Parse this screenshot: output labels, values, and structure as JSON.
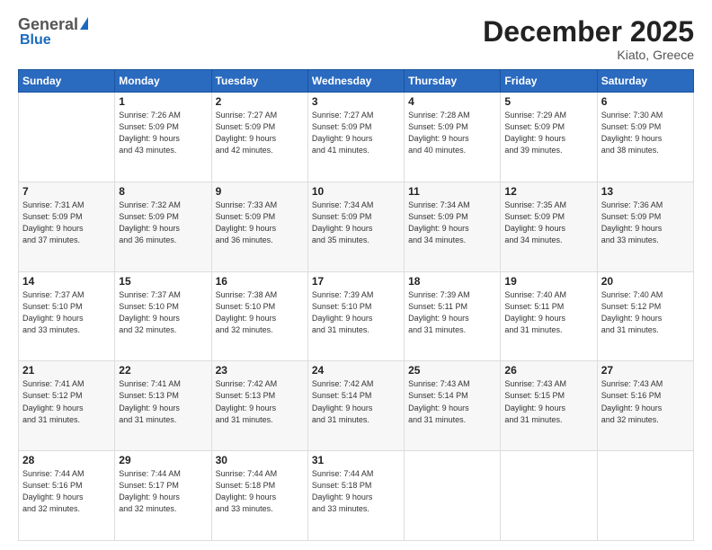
{
  "header": {
    "logo_general": "General",
    "logo_blue": "Blue",
    "month_title": "December 2025",
    "location": "Kiato, Greece"
  },
  "weekdays": [
    "Sunday",
    "Monday",
    "Tuesday",
    "Wednesday",
    "Thursday",
    "Friday",
    "Saturday"
  ],
  "weeks": [
    [
      {
        "day": "",
        "info": ""
      },
      {
        "day": "1",
        "info": "Sunrise: 7:26 AM\nSunset: 5:09 PM\nDaylight: 9 hours\nand 43 minutes."
      },
      {
        "day": "2",
        "info": "Sunrise: 7:27 AM\nSunset: 5:09 PM\nDaylight: 9 hours\nand 42 minutes."
      },
      {
        "day": "3",
        "info": "Sunrise: 7:27 AM\nSunset: 5:09 PM\nDaylight: 9 hours\nand 41 minutes."
      },
      {
        "day": "4",
        "info": "Sunrise: 7:28 AM\nSunset: 5:09 PM\nDaylight: 9 hours\nand 40 minutes."
      },
      {
        "day": "5",
        "info": "Sunrise: 7:29 AM\nSunset: 5:09 PM\nDaylight: 9 hours\nand 39 minutes."
      },
      {
        "day": "6",
        "info": "Sunrise: 7:30 AM\nSunset: 5:09 PM\nDaylight: 9 hours\nand 38 minutes."
      }
    ],
    [
      {
        "day": "7",
        "info": "Sunrise: 7:31 AM\nSunset: 5:09 PM\nDaylight: 9 hours\nand 37 minutes."
      },
      {
        "day": "8",
        "info": "Sunrise: 7:32 AM\nSunset: 5:09 PM\nDaylight: 9 hours\nand 36 minutes."
      },
      {
        "day": "9",
        "info": "Sunrise: 7:33 AM\nSunset: 5:09 PM\nDaylight: 9 hours\nand 36 minutes."
      },
      {
        "day": "10",
        "info": "Sunrise: 7:34 AM\nSunset: 5:09 PM\nDaylight: 9 hours\nand 35 minutes."
      },
      {
        "day": "11",
        "info": "Sunrise: 7:34 AM\nSunset: 5:09 PM\nDaylight: 9 hours\nand 34 minutes."
      },
      {
        "day": "12",
        "info": "Sunrise: 7:35 AM\nSunset: 5:09 PM\nDaylight: 9 hours\nand 34 minutes."
      },
      {
        "day": "13",
        "info": "Sunrise: 7:36 AM\nSunset: 5:09 PM\nDaylight: 9 hours\nand 33 minutes."
      }
    ],
    [
      {
        "day": "14",
        "info": "Sunrise: 7:37 AM\nSunset: 5:10 PM\nDaylight: 9 hours\nand 33 minutes."
      },
      {
        "day": "15",
        "info": "Sunrise: 7:37 AM\nSunset: 5:10 PM\nDaylight: 9 hours\nand 32 minutes."
      },
      {
        "day": "16",
        "info": "Sunrise: 7:38 AM\nSunset: 5:10 PM\nDaylight: 9 hours\nand 32 minutes."
      },
      {
        "day": "17",
        "info": "Sunrise: 7:39 AM\nSunset: 5:10 PM\nDaylight: 9 hours\nand 31 minutes."
      },
      {
        "day": "18",
        "info": "Sunrise: 7:39 AM\nSunset: 5:11 PM\nDaylight: 9 hours\nand 31 minutes."
      },
      {
        "day": "19",
        "info": "Sunrise: 7:40 AM\nSunset: 5:11 PM\nDaylight: 9 hours\nand 31 minutes."
      },
      {
        "day": "20",
        "info": "Sunrise: 7:40 AM\nSunset: 5:12 PM\nDaylight: 9 hours\nand 31 minutes."
      }
    ],
    [
      {
        "day": "21",
        "info": "Sunrise: 7:41 AM\nSunset: 5:12 PM\nDaylight: 9 hours\nand 31 minutes."
      },
      {
        "day": "22",
        "info": "Sunrise: 7:41 AM\nSunset: 5:13 PM\nDaylight: 9 hours\nand 31 minutes."
      },
      {
        "day": "23",
        "info": "Sunrise: 7:42 AM\nSunset: 5:13 PM\nDaylight: 9 hours\nand 31 minutes."
      },
      {
        "day": "24",
        "info": "Sunrise: 7:42 AM\nSunset: 5:14 PM\nDaylight: 9 hours\nand 31 minutes."
      },
      {
        "day": "25",
        "info": "Sunrise: 7:43 AM\nSunset: 5:14 PM\nDaylight: 9 hours\nand 31 minutes."
      },
      {
        "day": "26",
        "info": "Sunrise: 7:43 AM\nSunset: 5:15 PM\nDaylight: 9 hours\nand 31 minutes."
      },
      {
        "day": "27",
        "info": "Sunrise: 7:43 AM\nSunset: 5:16 PM\nDaylight: 9 hours\nand 32 minutes."
      }
    ],
    [
      {
        "day": "28",
        "info": "Sunrise: 7:44 AM\nSunset: 5:16 PM\nDaylight: 9 hours\nand 32 minutes."
      },
      {
        "day": "29",
        "info": "Sunrise: 7:44 AM\nSunset: 5:17 PM\nDaylight: 9 hours\nand 32 minutes."
      },
      {
        "day": "30",
        "info": "Sunrise: 7:44 AM\nSunset: 5:18 PM\nDaylight: 9 hours\nand 33 minutes."
      },
      {
        "day": "31",
        "info": "Sunrise: 7:44 AM\nSunset: 5:18 PM\nDaylight: 9 hours\nand 33 minutes."
      },
      {
        "day": "",
        "info": ""
      },
      {
        "day": "",
        "info": ""
      },
      {
        "day": "",
        "info": ""
      }
    ]
  ]
}
